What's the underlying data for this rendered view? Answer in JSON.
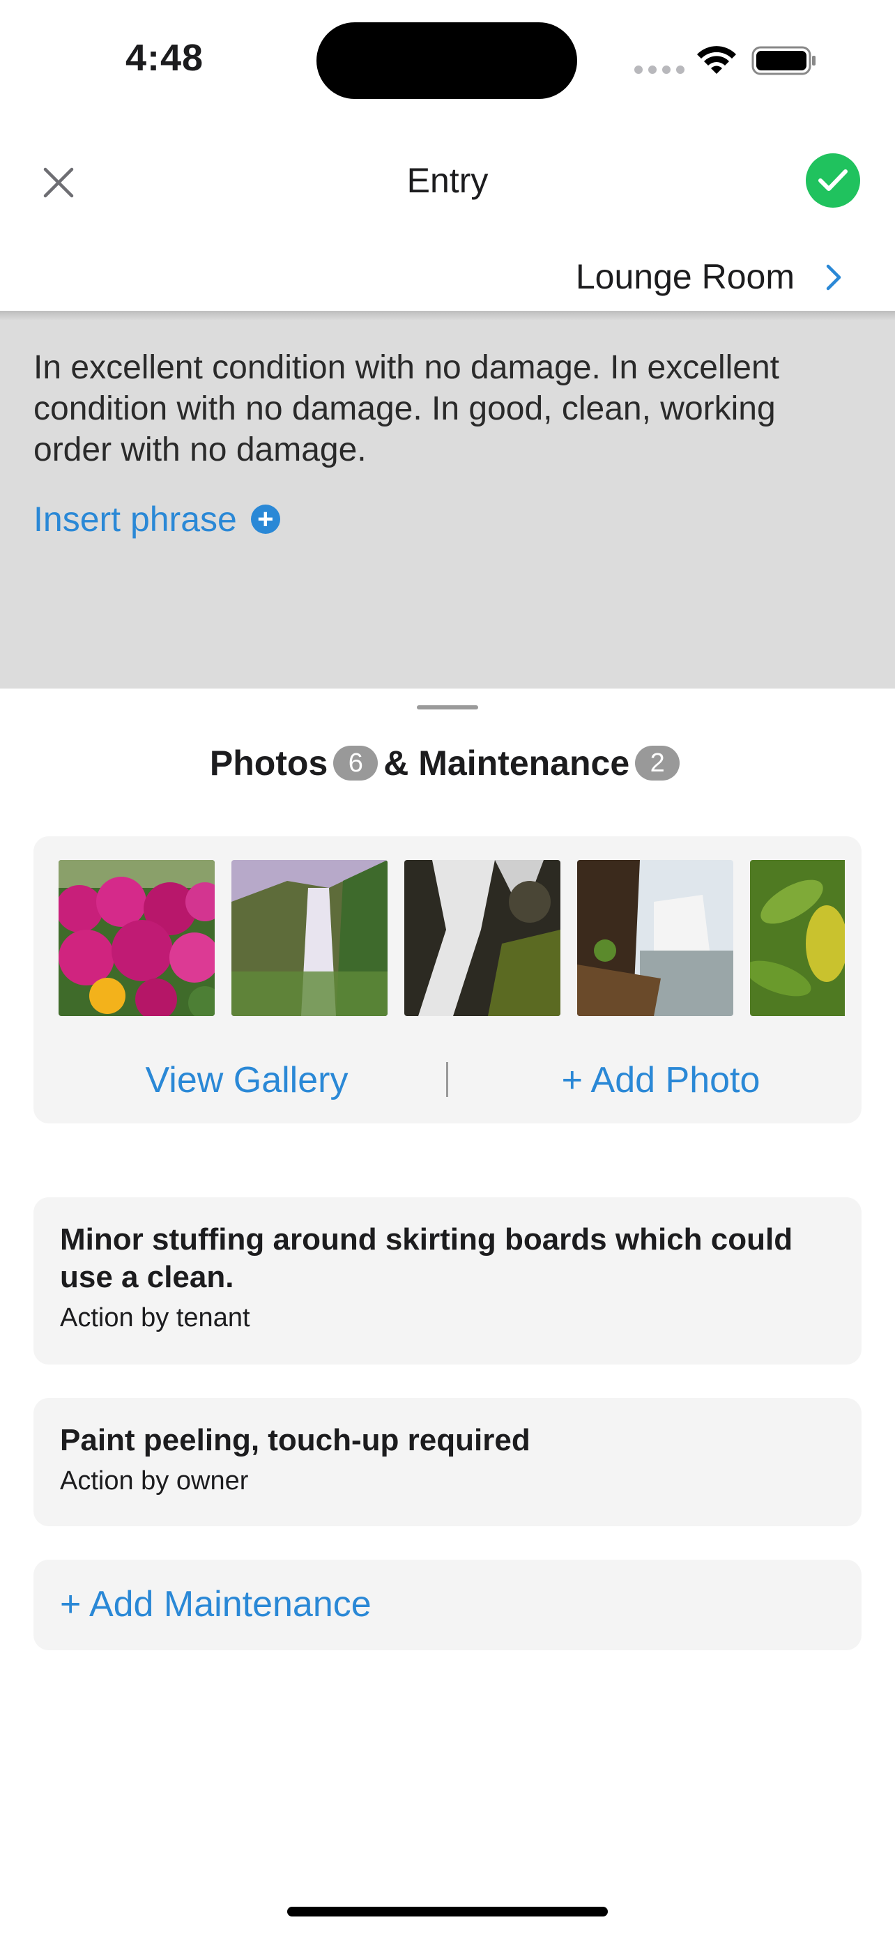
{
  "status_bar": {
    "time": "4:48"
  },
  "nav": {
    "title": "Entry",
    "room": "Lounge Room"
  },
  "entry": {
    "description": "In excellent condition with no damage. In excellent condition with no damage. In good, clean, working order with no damage.",
    "insert_phrase_label": "Insert phrase"
  },
  "sheet": {
    "photos_label": "Photos",
    "photos_count": "6",
    "maintenance_label": "& Maintenance",
    "maintenance_count": "2",
    "photos": [
      {
        "subject": "pink flowers"
      },
      {
        "subject": "waterfall cliff"
      },
      {
        "subject": "waterfall rocks"
      },
      {
        "subject": "waterfall shore"
      },
      {
        "subject": "green leaves"
      }
    ],
    "view_gallery_label": "View Gallery",
    "add_photo_label": "+ Add Photo",
    "maintenance_items": [
      {
        "title": "Minor stuffing around skirting boards which could use a clean.",
        "action": "Action by tenant"
      },
      {
        "title": "Paint peeling, touch-up required",
        "action": "Action by owner"
      }
    ],
    "add_maintenance_label": "+ Add Maintenance"
  },
  "colors": {
    "accent": "#2a88d6",
    "confirm": "#20c25e",
    "badge": "#999999",
    "card": "#f4f4f4",
    "overlay": "#dcdcdc"
  }
}
